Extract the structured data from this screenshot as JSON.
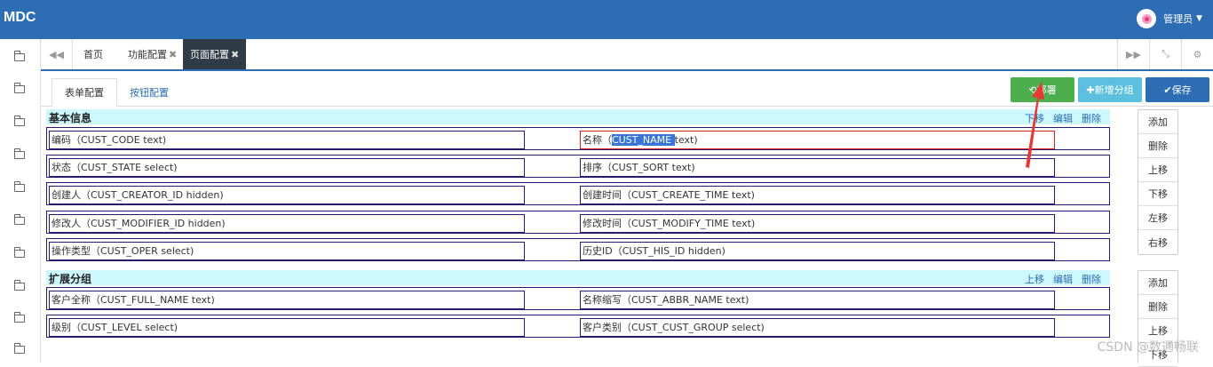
{
  "app": {
    "title": "MDC",
    "user": "管理员"
  },
  "tabs": [
    {
      "label": "首页",
      "closable": false
    },
    {
      "label": "功能配置",
      "closable": true
    },
    {
      "label": "页面配置",
      "closable": true,
      "active": true
    }
  ],
  "subtabs": [
    "表单配置",
    "按钮配置"
  ],
  "toolbar": {
    "deploy": "部署",
    "add_group": "新增分组",
    "save": "保存"
  },
  "colors": {
    "header": "#2c6db3",
    "deploy": "#4cae4c",
    "add_group": "#5bc0de",
    "save": "#2c6db3",
    "section": "#ccf7fc"
  },
  "sections": [
    {
      "title": "基本信息",
      "actions": [
        "下移",
        "编辑",
        "删除"
      ],
      "rows": [
        [
          "编码（CUST_CODE  text)",
          "名称（"
        ],
        [
          "状态（CUST_STATE  select)",
          "排序（CUST_SORT  text)"
        ],
        [
          "创建人（CUST_CREATOR_ID  hidden)",
          "创建时间（CUST_CREATE_TIME  text)"
        ],
        [
          "修改人（CUST_MODIFIER_ID  hidden)",
          "修改时间（CUST_MODIFY_TIME  text)"
        ],
        [
          "操作类型（CUST_OPER  select)",
          "历史ID（CUST_HIS_ID  hidden)"
        ]
      ],
      "selected": {
        "prefix": "名称（",
        "highlight": "CUST_NAME ",
        "suffix": " text)"
      },
      "side_buttons": [
        "添加",
        "删除",
        "上移",
        "下移",
        "左移",
        "右移"
      ]
    },
    {
      "title": "扩展分组",
      "actions": [
        "上移",
        "编辑",
        "删除"
      ],
      "rows": [
        [
          "客户全称（CUST_FULL_NAME  text)",
          "名称缩写（CUST_ABBR_NAME  text)"
        ],
        [
          "级别（CUST_LEVEL  select)",
          "客户类别（CUST_CUST_GROUP  select)"
        ]
      ],
      "side_buttons": [
        "添加",
        "删除",
        "上移",
        "下移"
      ]
    }
  ],
  "watermark": "CSDN @数通畅联"
}
